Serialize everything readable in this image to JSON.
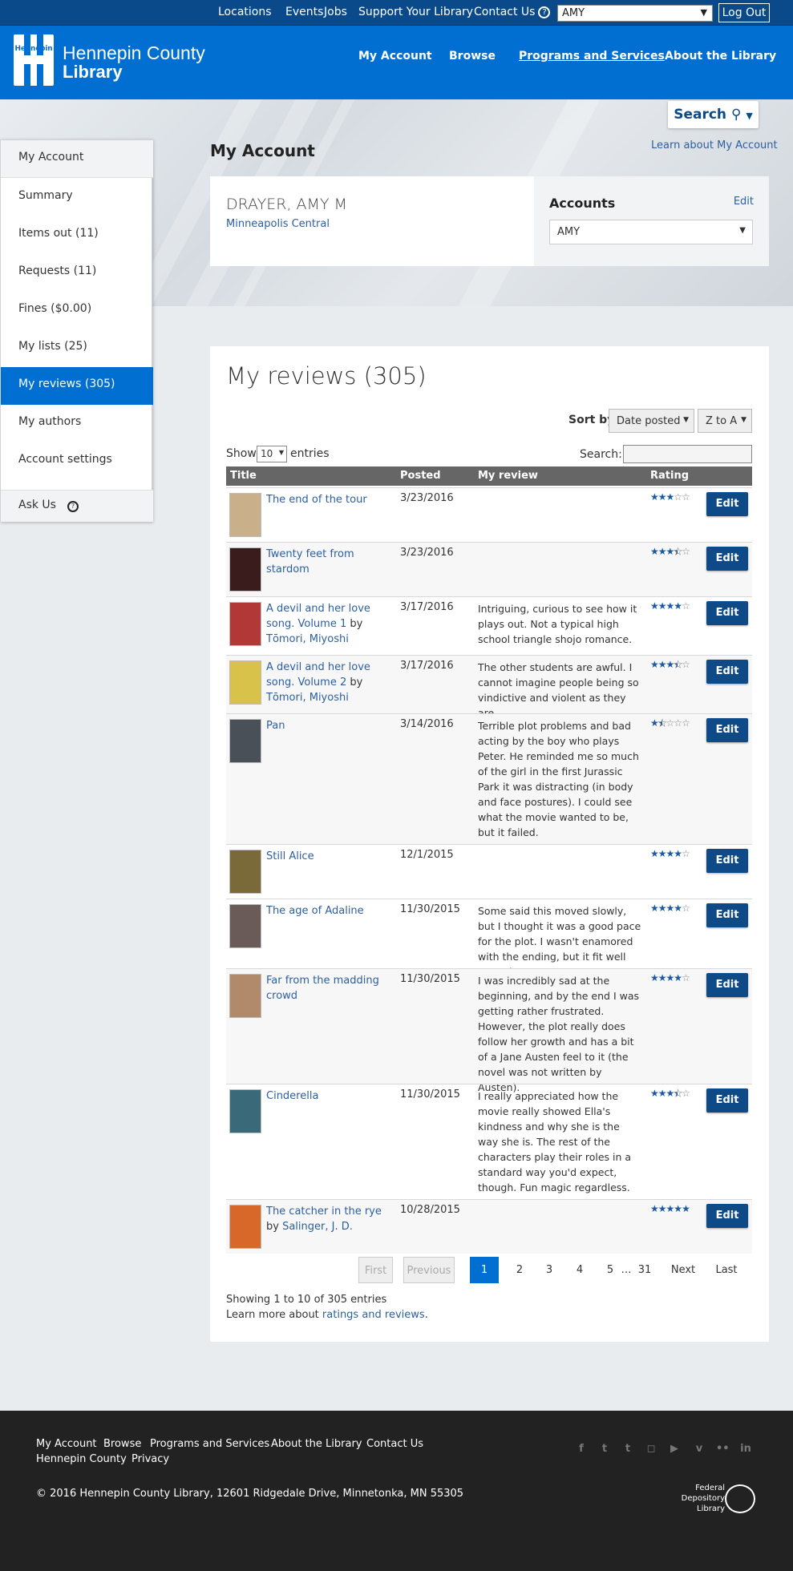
{
  "topbar": {
    "links": [
      "Locations",
      "Events",
      "Jobs",
      "Support Your Library",
      "Contact Us"
    ],
    "account_select": "AMY",
    "logout": "Log Out"
  },
  "header": {
    "logo_small": "Hennepin",
    "logo_line1": "Hennepin County",
    "logo_line2": "Library",
    "nav": [
      "My Account",
      "Browse",
      "Programs and Services",
      "About the Library"
    ]
  },
  "search": {
    "label": "Search"
  },
  "sidebar": {
    "items": [
      {
        "label": "My Account"
      },
      {
        "label": "Summary"
      },
      {
        "label": "Items out (11)"
      },
      {
        "label": "Requests (11)"
      },
      {
        "label": "Fines ($0.00)"
      },
      {
        "label": "My lists (25)"
      },
      {
        "label": "My reviews (305)"
      },
      {
        "label": "My authors"
      },
      {
        "label": "Account settings"
      },
      {
        "label": "Ask Us"
      }
    ]
  },
  "account": {
    "title": "My Account",
    "learn_link": "Learn about My Account",
    "name": "DRAYER, AMY M",
    "branch": "Minneapolis Central",
    "accounts_title": "Accounts",
    "accounts_edit": "Edit",
    "accounts_select": "AMY"
  },
  "reviews": {
    "title": "My reviews (305)",
    "sort_label": "Sort by",
    "sort_field": "Date posted",
    "sort_order": "Z to A",
    "show_label": "Show",
    "show_value": "10",
    "entries_label": "entries",
    "search_label": "Search:",
    "columns": [
      "Title",
      "Posted",
      "My review",
      "Rating"
    ],
    "edit_label": "Edit",
    "rows": [
      {
        "title": "The end of the tour",
        "author": "",
        "posted": "3/23/2016",
        "review": "",
        "rating": 3,
        "cover_color": "#c9b08a"
      },
      {
        "title": "Twenty feet from stardom",
        "author": "",
        "posted": "3/23/2016",
        "review": "",
        "rating": 3.5,
        "cover_color": "#3a1c1c"
      },
      {
        "title": "A devil and her love song. Volume 1",
        "author": "Tōmori, Miyoshi",
        "posted": "3/17/2016",
        "review": "Intriguing, curious to see how it plays out. Not a typical high school triangle shojo romance.",
        "rating": 4,
        "cover_color": "#b23838"
      },
      {
        "title": "A devil and her love song. Volume 2",
        "author": "Tōmori, Miyoshi",
        "posted": "3/17/2016",
        "review": "The other students are awful. I cannot imagine people being so vindictive and violent as they are.",
        "rating": 3.5,
        "cover_color": "#d8c24a"
      },
      {
        "title": "Pan",
        "author": "",
        "posted": "3/14/2016",
        "review": "Terrible plot problems and bad acting by the boy who plays Peter. He reminded me so much of the girl in the first Jurassic Park it was distracting (in body and face postures). I could see what the movie wanted to be, but it failed.",
        "rating": 1.5,
        "cover_color": "#4a5058"
      },
      {
        "title": "Still Alice",
        "author": "",
        "posted": "12/1/2015",
        "review": "",
        "rating": 4,
        "cover_color": "#7a6a3a"
      },
      {
        "title": "The age of Adaline",
        "author": "",
        "posted": "11/30/2015",
        "review": "Some said this moved slowly, but I thought it was a good pace for the plot. I wasn't enamored with the ending, but it fit well enough.",
        "rating": 4,
        "cover_color": "#6a5a58"
      },
      {
        "title": "Far from the madding crowd",
        "author": "",
        "posted": "11/30/2015",
        "review": "I was incredibly sad at the beginning, and by the end I was getting rather frustrated. However, the plot really does follow her growth and has a bit of a Jane Austen feel to it (the novel was not written by Austen).",
        "rating": 4,
        "cover_color": "#b08a6a"
      },
      {
        "title": "Cinderella",
        "author": "",
        "posted": "11/30/2015",
        "review": "I really appreciated how the movie really showed Ella's kindness and why she is the way she is. The rest of the characters play their roles in a standard way you'd expect, though. Fun magic regardless.",
        "rating": 3.5,
        "cover_color": "#3a6a7a"
      },
      {
        "title": "The catcher in the rye",
        "author": "Salinger, J. D.",
        "posted": "10/28/2015",
        "review": "",
        "rating": 5,
        "cover_color": "#d8682a"
      }
    ]
  },
  "pagination": {
    "buttons": [
      "First",
      "Previous",
      "1",
      "2",
      "3",
      "4",
      "5",
      "…",
      "31",
      "Next",
      "Last"
    ],
    "showing": "Showing 1 to 10 of 305 entries",
    "learn_more_prefix": "Learn more about",
    "learn_more_link": "ratings and reviews",
    "learn_more_suffix": "."
  },
  "footer": {
    "links": [
      "My Account",
      "Browse",
      "Programs and Services",
      "About the Library",
      "Contact Us",
      "Hennepin County",
      "Privacy"
    ],
    "copyright": "© 2016 Hennepin County Library, 12601 Ridgedale Drive, Minnetonka, MN 55305",
    "fdl_lines": [
      "Federal",
      "Depository",
      "Library"
    ],
    "social_icons": [
      "facebook-icon",
      "twitter-icon",
      "tumblr-icon",
      "instagram-icon",
      "youtube-icon",
      "vimeo-icon",
      "flickr-icon",
      "linkedin-icon"
    ]
  },
  "colors": {
    "brand_blue": "#006fd1",
    "dark_blue": "#0e4a87",
    "footer": "#222222"
  }
}
